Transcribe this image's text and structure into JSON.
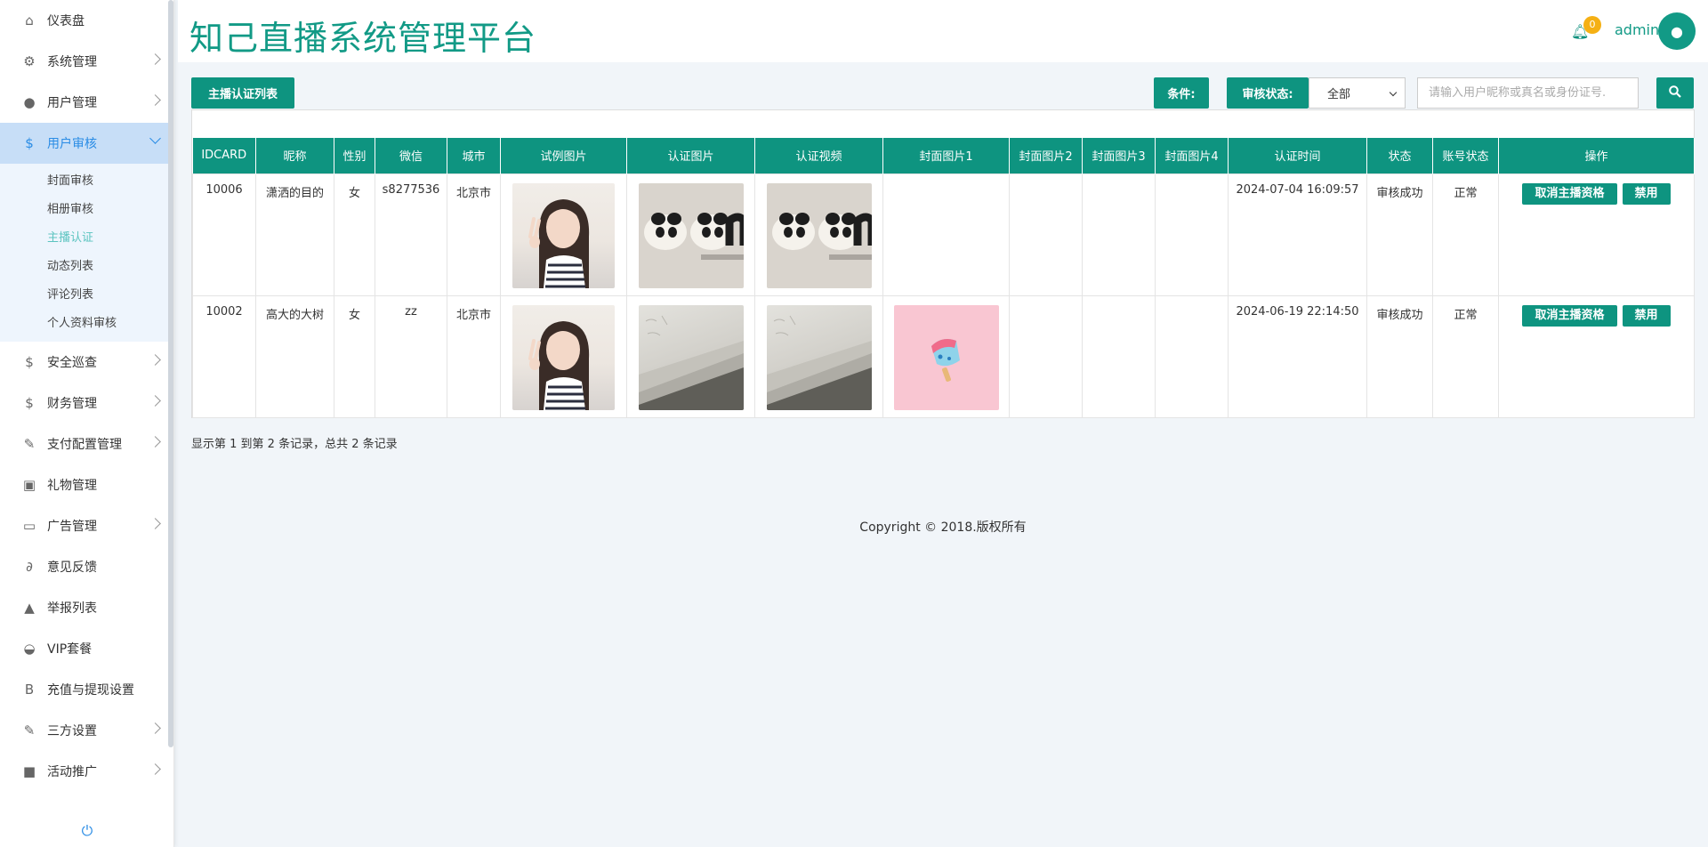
{
  "header": {
    "title": "知己直播系统管理平台",
    "notification_count": "0",
    "user": "admin"
  },
  "sidebar": {
    "items": [
      {
        "label": "仪表盘",
        "icon": "home-icon",
        "glyph": "⌂",
        "arrow": false
      },
      {
        "label": "系统管理",
        "icon": "cogs-icon",
        "glyph": "⚙",
        "arrow": true
      },
      {
        "label": "用户管理",
        "icon": "user-icon",
        "glyph": "●",
        "arrow": true
      },
      {
        "label": "用户审核",
        "icon": "dollar-icon",
        "glyph": "$",
        "arrow": true,
        "active": true
      },
      {
        "label": "安全巡查",
        "icon": "dollar-icon",
        "glyph": "$",
        "arrow": true
      },
      {
        "label": "财务管理",
        "icon": "dollar-icon",
        "glyph": "$",
        "arrow": true
      },
      {
        "label": "支付配置管理",
        "icon": "wrench-icon",
        "glyph": "✎",
        "arrow": true
      },
      {
        "label": "礼物管理",
        "icon": "gift-icon",
        "glyph": "▣",
        "arrow": false
      },
      {
        "label": "广告管理",
        "icon": "desktop-icon",
        "glyph": "▭",
        "arrow": true
      },
      {
        "label": "意见反馈",
        "icon": "paperclip-icon",
        "glyph": "∂",
        "arrow": false
      },
      {
        "label": "举报列表",
        "icon": "warning-icon",
        "glyph": "▲",
        "arrow": false
      },
      {
        "label": "VIP套餐",
        "icon": "piggy-bank-icon",
        "glyph": "◒",
        "arrow": false
      },
      {
        "label": "充值与提现设置",
        "icon": "bitcoin-icon",
        "glyph": "B",
        "arrow": false
      },
      {
        "label": "三方设置",
        "icon": "wrench-icon",
        "glyph": "✎",
        "arrow": true
      },
      {
        "label": "活动推广",
        "icon": "briefcase-icon",
        "glyph": "■",
        "arrow": true
      }
    ],
    "submenu": [
      "封面审核",
      "相册审核",
      "主播认证",
      "动态列表",
      "评论列表",
      "个人资料审核"
    ],
    "submenu_current": "主播认证"
  },
  "toolbar": {
    "list_button": "主播认证列表",
    "condition_label": "条件:",
    "status_label": "审核状态:",
    "status_value": "全部",
    "search_placeholder": "请输入用户昵称或真名或身份证号."
  },
  "table": {
    "columns": [
      "IDCARD",
      "昵称",
      "性别",
      "微信",
      "城市",
      "试例图片",
      "认证图片",
      "认证视频",
      "封面图片1",
      "封面图片2",
      "封面图片3",
      "封面图片4",
      "认证时间",
      "状态",
      "账号状态",
      "操作"
    ],
    "rows": [
      {
        "idcard": "10006",
        "nickname": "潇洒的目的",
        "gender": "女",
        "wechat": "s8277536",
        "city": "北京市",
        "sample_img": "girl",
        "cert_img": "panda",
        "cert_video": "panda",
        "cover1": "",
        "time": "2024-07-04 16:09:57",
        "status": "审核成功",
        "account_status": "正常",
        "cancel_btn": "取消主播资格",
        "ban_btn": "禁用"
      },
      {
        "idcard": "10002",
        "nickname": "高大的大树",
        "gender": "女",
        "wechat": "zz",
        "city": "北京市",
        "sample_img": "girl",
        "cert_img": "paper",
        "cert_video": "paper",
        "cover1": "icecream",
        "time": "2024-06-19 22:14:50",
        "status": "审核成功",
        "account_status": "正常",
        "cancel_btn": "取消主播资格",
        "ban_btn": "禁用"
      }
    ]
  },
  "summary": "显示第 1 到第 2 条记录，总共 2 条记录",
  "footer": "Copyright © 2018.版权所有",
  "colors": {
    "accent": "#0e9480",
    "title": "#129a86",
    "badge": "#f5b014",
    "active_bg": "#c7def7"
  }
}
